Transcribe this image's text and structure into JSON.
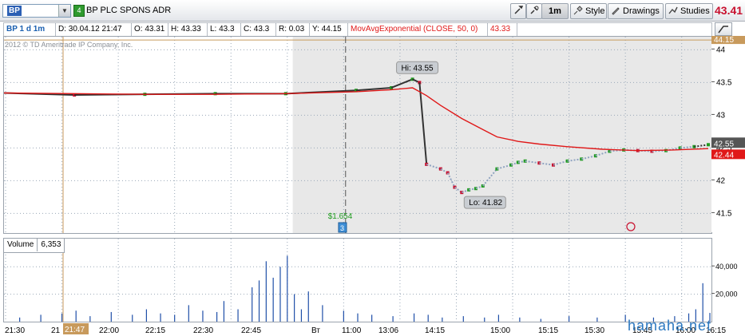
{
  "toolbar": {
    "symbol": "BP",
    "level": "4",
    "company": "BP PLC SPONS ADR",
    "interval_button": "1m",
    "style_label": "Style",
    "drawings_label": "Drawings",
    "studies_label": "Studies",
    "last_price": "43.41"
  },
  "header": {
    "title": "BP 1 d 1m",
    "date": "D: 30.04.12 21:47",
    "open": "O: 43.31",
    "high": "H: 43.33",
    "low": "L: 43.3",
    "close": "C: 43.3",
    "range": "R: 0.03",
    "y": "Y: 44.15",
    "study": "MovAvgExponential (CLOSE, 50, 0)",
    "study_value": "43.33"
  },
  "copyright": "2012 © TD Ameritrade IP Company, Inc.",
  "volume_panel": {
    "label": "Volume",
    "value": "6,353"
  },
  "watermark": "hamaha.net",
  "colors": {
    "up": "#1f9b1f",
    "down": "#c8102e",
    "ema": "#e01818",
    "shade": "#e8e8e8",
    "grid": "#9aa8b8",
    "cursor": "#c89a5c",
    "last_price_bg": "#555555"
  },
  "chart_data": {
    "type": "line",
    "price_axis": {
      "ticks": [
        "44",
        "43.5",
        "43",
        "42.5",
        "42",
        "41.5"
      ],
      "ylim": [
        41.2,
        44.2
      ]
    },
    "volume_axis": {
      "ticks": [
        "40,000",
        "20,000"
      ],
      "ylim": [
        0,
        50000
      ]
    },
    "x_ticks": [
      "21:30",
      "21",
      "22:00",
      "22:15",
      "22:30",
      "22:45",
      "Вт",
      "11:00",
      "13:06",
      "14:15",
      "15:00",
      "15:15",
      "15:30",
      "15:45",
      "16:00",
      "16:15"
    ],
    "crosshair": {
      "time_label": "21:47",
      "price_label": "44.15"
    },
    "annotations": {
      "high_label": "Hi: 43.55",
      "low_label": "Lo: 41.82",
      "dividend_label": "$1.654",
      "event_marker": "3"
    },
    "price_labels": {
      "last": "42.55",
      "ema": "42.44"
    },
    "series": [
      {
        "name": "MovAvgExponential (CLOSE, 50, 0)",
        "x": [
          0,
          10,
          20,
          30,
          40,
          50,
          55,
          58,
          60,
          62,
          65,
          68,
          70,
          73,
          76,
          80,
          85,
          90,
          95,
          100
        ],
        "values": [
          43.34,
          43.33,
          43.32,
          43.32,
          43.33,
          43.36,
          43.39,
          43.42,
          43.3,
          43.15,
          42.95,
          42.78,
          42.67,
          42.6,
          42.56,
          42.52,
          42.48,
          42.46,
          42.47,
          42.49
        ]
      },
      {
        "name": "Price",
        "x": [
          0,
          10,
          20,
          30,
          40,
          50,
          55,
          58,
          59,
          60,
          62,
          63,
          64,
          65,
          66,
          67,
          68,
          70,
          72,
          73,
          74,
          76,
          78,
          80,
          82,
          84,
          86,
          88,
          90,
          92,
          94,
          96,
          98,
          100
        ],
        "values": [
          43.34,
          43.31,
          43.32,
          43.33,
          43.33,
          43.38,
          43.42,
          43.55,
          43.5,
          42.25,
          42.18,
          42.12,
          41.9,
          41.82,
          41.86,
          41.88,
          41.92,
          42.18,
          42.24,
          42.28,
          42.3,
          42.27,
          42.24,
          42.3,
          42.33,
          42.38,
          42.45,
          42.47,
          42.46,
          42.45,
          42.46,
          42.5,
          42.52,
          42.55
        ]
      }
    ],
    "volume": {
      "x": [
        2,
        5,
        8,
        10,
        12,
        15,
        18,
        20,
        22,
        24,
        26,
        28,
        30,
        31,
        33,
        35,
        36,
        37,
        38,
        39,
        40,
        41,
        42,
        43,
        45,
        48,
        50,
        52,
        55,
        58,
        60,
        62,
        65,
        68,
        70,
        73,
        76,
        80,
        84,
        88,
        92,
        95,
        97,
        98,
        99,
        100
      ],
      "values": [
        3000,
        5000,
        6000,
        8000,
        4000,
        7000,
        5000,
        9000,
        6000,
        5000,
        12000,
        8000,
        7000,
        15000,
        9000,
        25000,
        30000,
        44000,
        32000,
        40000,
        48000,
        20000,
        9000,
        22000,
        12000,
        8000,
        6000,
        5000,
        4000,
        6000,
        5000,
        3000,
        4000,
        3000,
        5000,
        3000,
        2000,
        4000,
        3000,
        5000,
        3000,
        4000,
        6000,
        9000,
        28000,
        6353
      ]
    }
  }
}
